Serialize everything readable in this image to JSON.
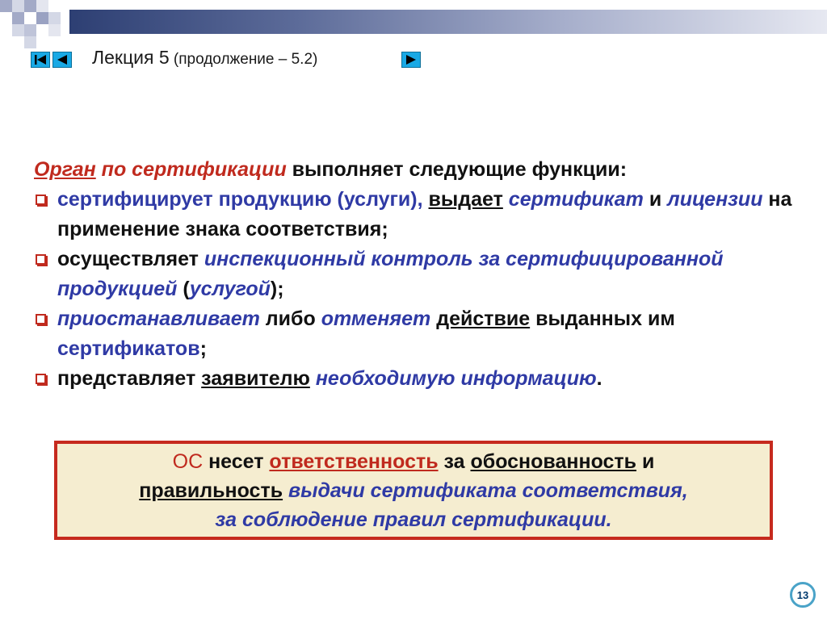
{
  "header": {
    "title": "Лекция 5",
    "subtitle": " (продолжение – 5.2)"
  },
  "nav": {
    "first_icon": "skip-to-start-icon",
    "prev_icon": "triangle-left-icon",
    "next_icon": "triangle-right-icon"
  },
  "intro": {
    "organ": "Орган",
    "po_sert": " по сертификации",
    "rest": " выполняет следующие функции:"
  },
  "bullets": {
    "b1": {
      "p1": "сертифицирует продукцию (услуги), ",
      "p2": "выдает",
      "p3": " ",
      "p4": "сертификат",
      "p5": " и ",
      "p6": "лицензии",
      "p7": " на применение знака соответствия;"
    },
    "b2": {
      "p1": "осуществляет ",
      "p2": "инспекционный контроль за сертифицированной продукцией",
      "p3": " (",
      "p4": "услугой",
      "p5": ");"
    },
    "b3": {
      "p1": "приостанавливает",
      "p2": " либо ",
      "p3": "отменяет",
      "p4": " ",
      "p5": "действие",
      "p6": " выданных им ",
      "p7": "сертификатов",
      "p8": ";"
    },
    "b4": {
      "p1": "представляет ",
      "p2": "заявителю",
      "p3": " ",
      "p4": "необходимую информацию",
      "p5": "."
    }
  },
  "box": {
    "os": "ОС",
    "t1": " несет ",
    "resp": "ответственность",
    "t2": " за ",
    "obosn": "обоснованность",
    "t3": " и",
    "prav": "правильность",
    "t4": " ",
    "vyd": "выдачи сертификата соответствия,",
    "line3": "за соблюдение правил сертификации."
  },
  "page_number": "13",
  "colors": {
    "red": "#c02a1e",
    "blue": "#2f3aa5",
    "nav_blue": "#19a9e5",
    "box_bg": "#f5edd0"
  }
}
